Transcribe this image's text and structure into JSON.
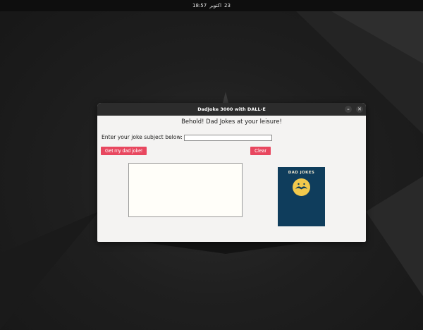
{
  "system": {
    "clock_day": "23",
    "clock_month": "اكتوبر",
    "clock_time": "18:57"
  },
  "window": {
    "title": "DadJoke 3000 with DALL-E",
    "minimize_glyph": "–",
    "close_glyph": "✕"
  },
  "app": {
    "heading": "Behold! Dad Jokes at your leisure!",
    "subject_prompt": "Enter your joke subject below:",
    "subject_value": "",
    "get_button": "Get my dad joke!",
    "clear_button": "Clear",
    "joke_text": ""
  },
  "image": {
    "book_title": "DAD JOKES",
    "icon": "mustache-face-icon"
  },
  "colors": {
    "accent_button": "#e8475f",
    "book_cover": "#0f3d5c",
    "emblem": "#f2c94c"
  }
}
